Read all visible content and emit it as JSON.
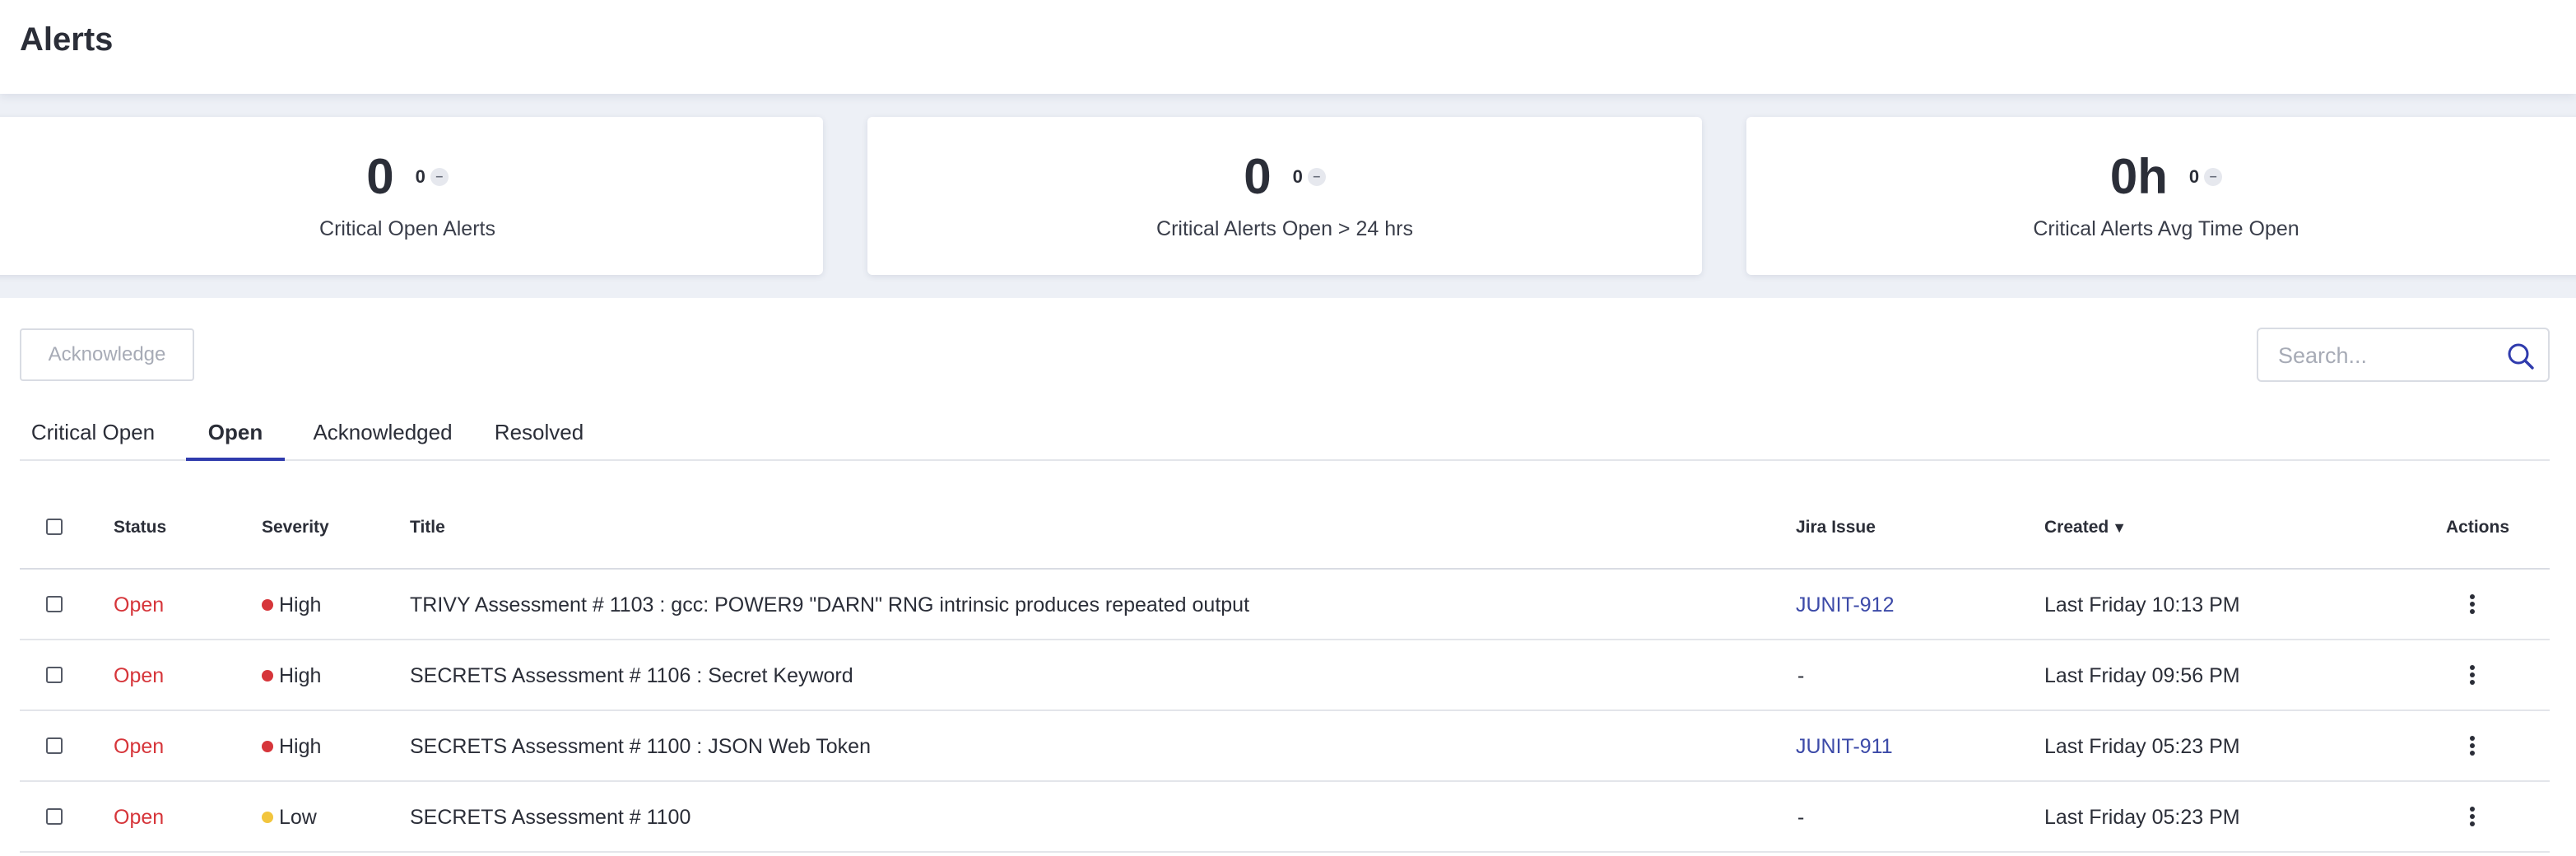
{
  "header": {
    "title": "Alerts"
  },
  "stats": [
    {
      "value": "0",
      "delta": "0",
      "delta_indicator": "–",
      "label": "Critical Open Alerts"
    },
    {
      "value": "0",
      "delta": "0",
      "delta_indicator": "–",
      "label": "Critical Alerts Open > 24 hrs"
    },
    {
      "value": "0h",
      "delta": "0",
      "delta_indicator": "–",
      "label": "Critical Alerts Avg Time Open"
    }
  ],
  "toolbar": {
    "acknowledge_label": "Acknowledge"
  },
  "search": {
    "placeholder": "Search...",
    "icon": "search-icon"
  },
  "tabs": [
    {
      "label": "Critical Open",
      "active": false
    },
    {
      "label": "Open",
      "active": true
    },
    {
      "label": "Acknowledged",
      "active": false
    },
    {
      "label": "Resolved",
      "active": false
    }
  ],
  "table": {
    "columns": {
      "status": "Status",
      "severity": "Severity",
      "title": "Title",
      "jira": "Jira Issue",
      "created": "Created",
      "created_sort_icon": "▼",
      "actions": "Actions"
    },
    "rows": [
      {
        "status": "Open",
        "severity": "High",
        "title": "TRIVY Assessment # 1103 : gcc: POWER9 \"DARN\" RNG intrinsic produces repeated output",
        "jira": "JUNIT-912",
        "created": "Last Friday 10:13 PM"
      },
      {
        "status": "Open",
        "severity": "High",
        "title": "SECRETS Assessment # 1106 : Secret Keyword",
        "jira": "-",
        "created": "Last Friday 09:56 PM"
      },
      {
        "status": "Open",
        "severity": "High",
        "title": "SECRETS Assessment # 1100 : JSON Web Token",
        "jira": "JUNIT-911",
        "created": "Last Friday 05:23 PM"
      },
      {
        "status": "Open",
        "severity": "Low",
        "title": "SECRETS Assessment # 1100",
        "jira": "-",
        "created": "Last Friday 05:23 PM"
      }
    ]
  },
  "colors": {
    "accent": "#2f3bad",
    "status_open": "#d6353a",
    "severity_high": "#d6353a",
    "severity_low": "#f2c53d",
    "link": "#3c4aa8",
    "band_bg": "#edf0f6"
  }
}
